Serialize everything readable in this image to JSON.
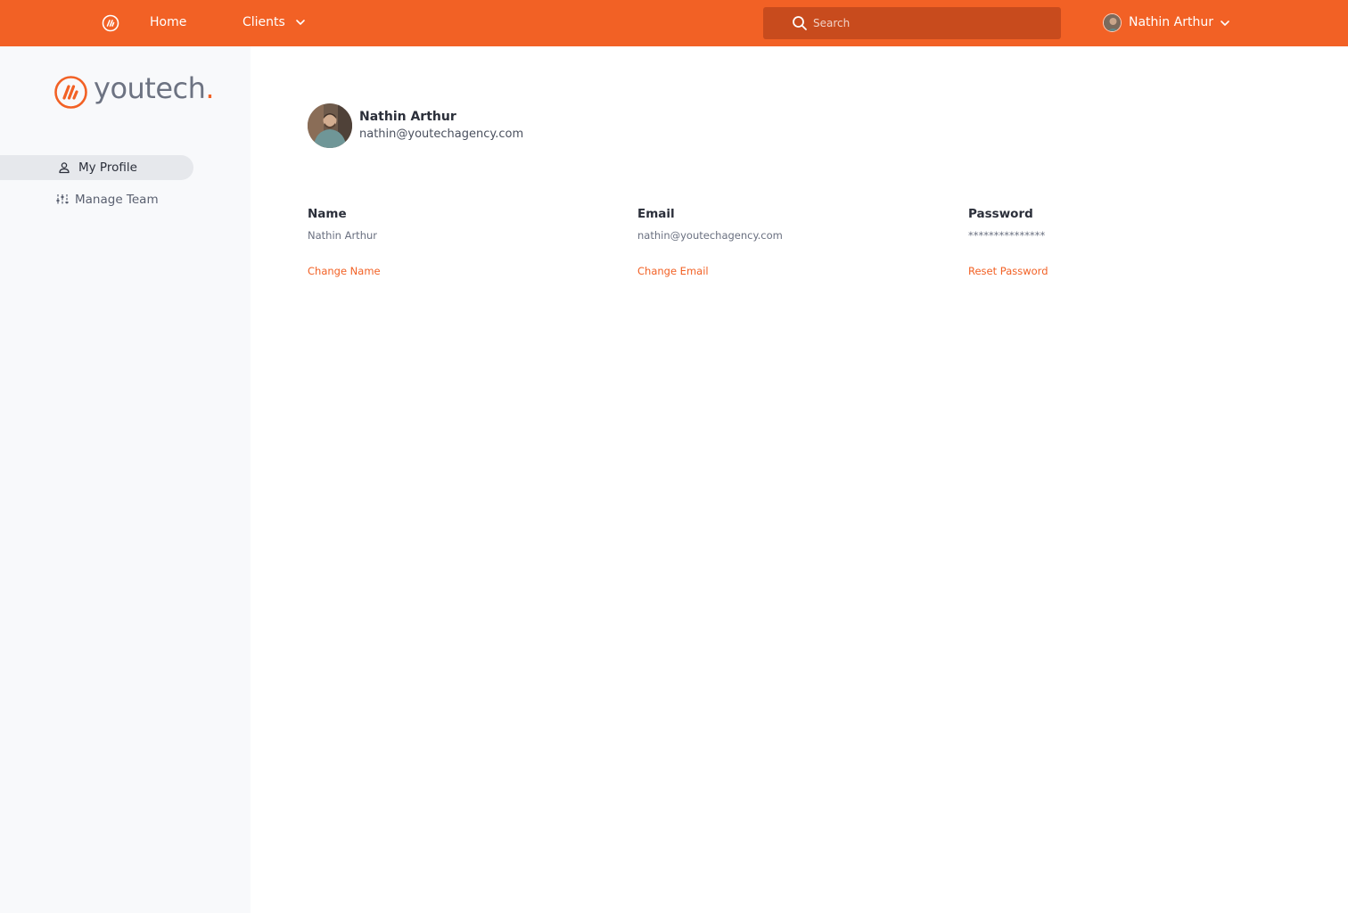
{
  "colors": {
    "accent": "#f26125",
    "search_bg": "#c84b1d",
    "sidebar_bg": "#f8f9fb",
    "active_item_bg": "#e6e8ec"
  },
  "topbar": {
    "logo_icon": "youtech-mark-icon",
    "nav": {
      "home": "Home",
      "clients": "Clients"
    },
    "search": {
      "placeholder": "Search",
      "value": ""
    },
    "user": {
      "name": "Nathin Arthur"
    }
  },
  "sidebar": {
    "brand": {
      "text": "youtech",
      "dot": "."
    },
    "items": [
      {
        "label": "My Profile",
        "icon": "user-icon",
        "active": true
      },
      {
        "label": "Manage Team",
        "icon": "sliders-icon",
        "active": false
      }
    ]
  },
  "profile": {
    "name": "Nathin Arthur",
    "email": "nathin@youtechagency.com",
    "fields": [
      {
        "label": "Name",
        "value": "Nathin Arthur",
        "action": "Change Name"
      },
      {
        "label": "Email",
        "value": "nathin@youtechagency.com",
        "action": "Change Email"
      },
      {
        "label": "Password",
        "value": "***************",
        "action": "Reset Password"
      }
    ]
  }
}
